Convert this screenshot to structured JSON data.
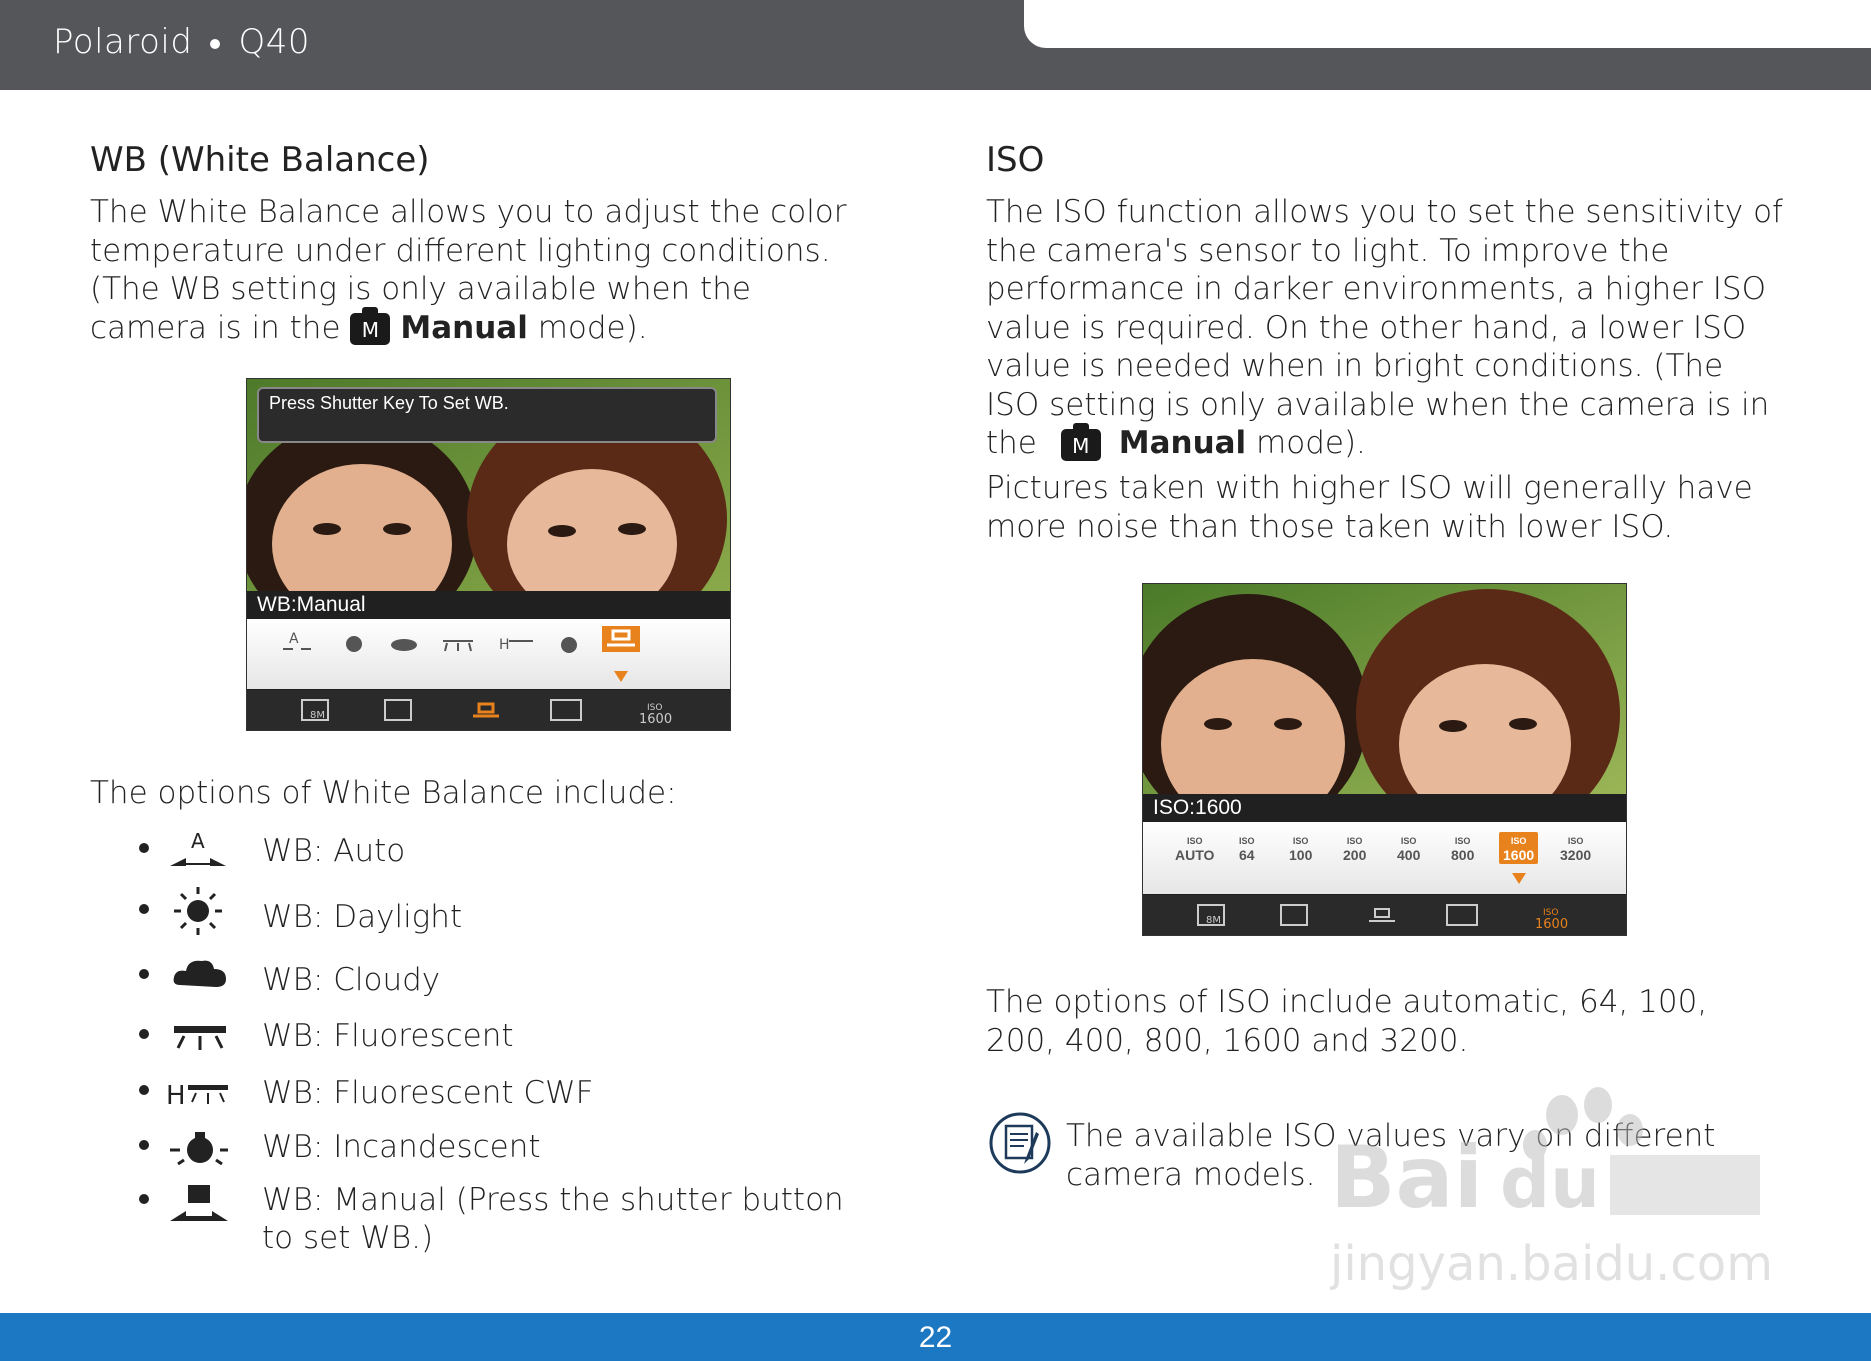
{
  "header": {
    "brand": "Polaroid",
    "model": "Q40"
  },
  "left": {
    "wb_title": "WB (White Balance)",
    "wb_intro_1": "The White Balance allows you to adjust the color temperature under different lighting conditions. (The WB setting is only available when the camera is in the",
    "wb_intro_manual": "Manual",
    "wb_intro_2": "mode).",
    "m_icon_letter": "M",
    "screen": {
      "tip": "Press Shutter Key To Set WB.",
      "label": "WB:Manual",
      "iso_badge_top": "ISO",
      "iso_badge_val": "1600"
    },
    "options_heading": "The options of White Balance include:",
    "options": [
      {
        "icon": "wb-auto-icon",
        "label": "WB: Auto"
      },
      {
        "icon": "daylight-icon",
        "label": "WB: Daylight"
      },
      {
        "icon": "cloudy-icon",
        "label": "WB: Cloudy"
      },
      {
        "icon": "fluorescent-icon",
        "label": "WB: Fluorescent"
      },
      {
        "icon": "fluorescent-cwf-icon",
        "label": "WB: Fluorescent CWF"
      },
      {
        "icon": "incandescent-icon",
        "label": "WB: Incandescent"
      },
      {
        "icon": "wb-manual-icon",
        "label": "WB: Manual (Press the shutter button to set WB.)"
      }
    ]
  },
  "right": {
    "iso_title": "ISO",
    "iso_intro_1": "The ISO function allows you to set the sensitivity of the camera's sensor to light. To improve the performance in darker environments, a higher ISO value is required. On the other hand, a lower ISO value is needed when in bright conditions. (The ISO setting is only available when the camera is in the",
    "iso_intro_manual": "Manual",
    "iso_intro_2": "mode).",
    "noise_text": "Pictures taken with higher ISO will generally have more noise than those taken with lower ISO.",
    "screen": {
      "label": "ISO:1600",
      "iso_word": "ISO",
      "options": [
        "AUTO",
        "64",
        "100",
        "200",
        "400",
        "800",
        "1600",
        "3200"
      ],
      "selected": "1600"
    },
    "options_text": "The options of ISO include automatic, 64, 100, 200, 400, 800, 1600 and 3200.",
    "note_text": "The available ISO values vary on different camera models."
  },
  "watermark": {
    "brand": "Baidu经验",
    "url": "jingyan.baidu.com"
  },
  "footer": {
    "page_number": "22"
  },
  "colors": {
    "header": "#55565a",
    "footer": "#1d78c4",
    "accent": "#e8821c"
  }
}
